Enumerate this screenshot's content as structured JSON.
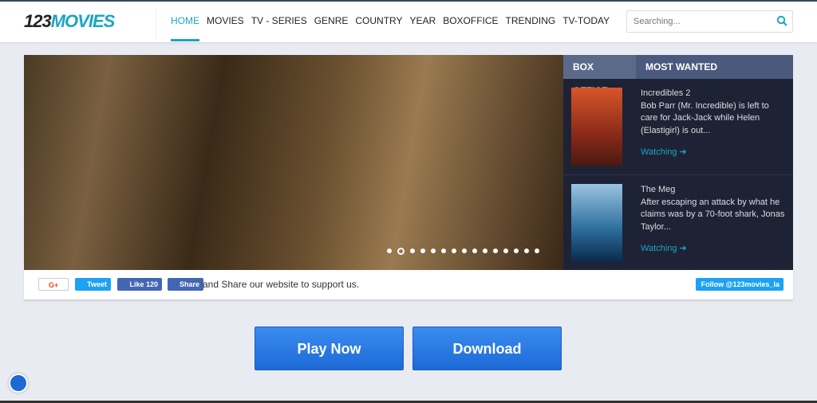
{
  "logo": {
    "part1": "123",
    "part2": "MOVIES"
  },
  "nav": [
    "HOME",
    "MOVIES",
    "TV - SERIES",
    "GENRE",
    "COUNTRY",
    "YEAR",
    "BOXOFFICE",
    "TRENDING",
    "TV-TODAY"
  ],
  "search": {
    "placeholder": "Searching..."
  },
  "slider": {
    "dot_count": 15,
    "active_dot": 2
  },
  "side": {
    "tabs": [
      "BOX OFFICE",
      "MOST WANTED"
    ],
    "items": [
      {
        "title": "Incredibles 2",
        "desc": "Bob Parr (Mr. Incredible) is left to care for Jack-Jack while Helen (Elastigirl) is out...",
        "link": "Watching"
      },
      {
        "title": "The Meg",
        "desc": "After escaping an attack by what he claims was by a 70-foot shark, Jonas Taylor...",
        "link": "Watching"
      }
    ]
  },
  "share": {
    "gplus": "G+",
    "tweet": "Tweet",
    "like": "Like 120",
    "fbshare": "Share",
    "text": "and Share our website to support us.",
    "follow": "Follow @123movies_la"
  },
  "buttons": {
    "play": "Play Now",
    "download": "Download"
  },
  "colors": {
    "accent": "#1aa6c4",
    "button": "#2a7ce6"
  }
}
